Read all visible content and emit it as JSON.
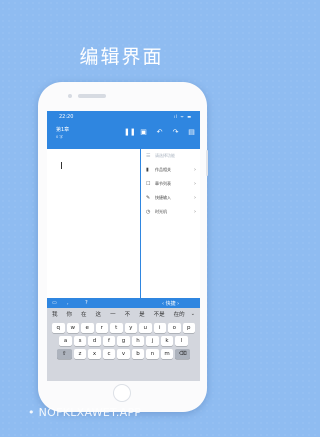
{
  "headline": "编辑界面",
  "status": {
    "time": "22:20",
    "icons": "ıl ᯤ ▬"
  },
  "toolbar": {
    "title": "第1章",
    "subtitle": "0 字",
    "icons": [
      "pause-icon",
      "note-icon",
      "undo-icon",
      "redo-icon",
      "save-icon"
    ]
  },
  "panel": {
    "items": [
      {
        "icon": "☰",
        "label": "请选择功能"
      },
      {
        "icon": "▮",
        "label": "作品相关",
        "arrow": "›"
      },
      {
        "icon": "☐",
        "label": "章节列表",
        "arrow": "›"
      },
      {
        "icon": "✎",
        "label": "快捷输入",
        "arrow": "›"
      },
      {
        "icon": "◷",
        "label": "时光机",
        "arrow": "›"
      }
    ]
  },
  "kb_toolbar": {
    "left": "▭",
    "comma": ",",
    "question": "?",
    "right": "‹  快捷  ›"
  },
  "keyboard": {
    "candidates": [
      "我",
      "你",
      "在",
      "这",
      "一",
      "不",
      "是",
      "不是",
      "在的"
    ],
    "more": "⌄",
    "row1": [
      "q",
      "w",
      "e",
      "r",
      "t",
      "y",
      "u",
      "i",
      "o",
      "p"
    ],
    "row2": [
      "a",
      "s",
      "d",
      "f",
      "g",
      "h",
      "j",
      "k",
      "l"
    ],
    "row3": [
      "⇧",
      "z",
      "x",
      "c",
      "v",
      "b",
      "n",
      "m",
      "⌫"
    ]
  },
  "watermark": "• NOFKLXAWET.APP"
}
